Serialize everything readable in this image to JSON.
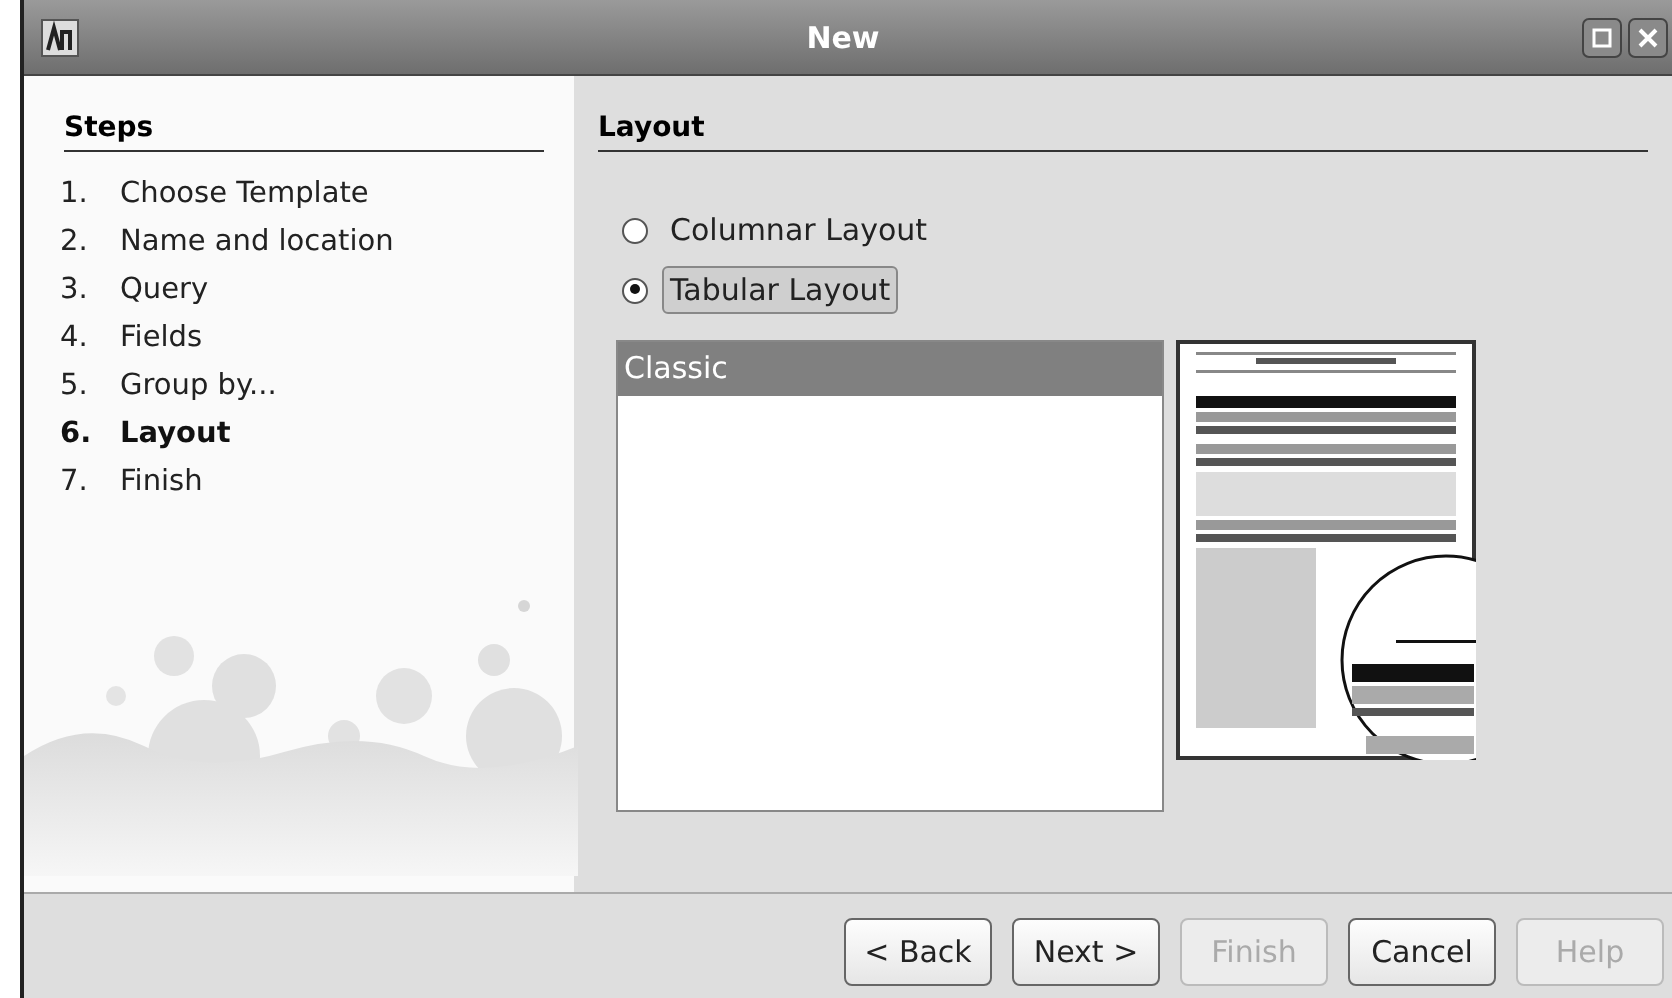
{
  "window": {
    "title": "New"
  },
  "steps": {
    "heading": "Steps",
    "items": [
      {
        "number": "1.",
        "label": "Choose Template",
        "selected": false
      },
      {
        "number": "2.",
        "label": "Name and location",
        "selected": false
      },
      {
        "number": "3.",
        "label": "Query",
        "selected": false
      },
      {
        "number": "4.",
        "label": "Fields",
        "selected": false
      },
      {
        "number": "5.",
        "label": "Group by...",
        "selected": false
      },
      {
        "number": "6.",
        "label": "Layout",
        "selected": true
      },
      {
        "number": "7.",
        "label": "Finish",
        "selected": false
      }
    ]
  },
  "page": {
    "heading": "Layout",
    "layout_options": [
      {
        "label": "Columnar Layout",
        "selected": false
      },
      {
        "label": "Tabular Layout",
        "selected": true
      }
    ],
    "templates": [
      {
        "label": "Classic",
        "selected": true
      }
    ]
  },
  "buttons": [
    {
      "label": "< Back",
      "disabled": false
    },
    {
      "label": "Next >",
      "disabled": false
    },
    {
      "label": "Finish",
      "disabled": true
    },
    {
      "label": "Cancel",
      "disabled": false
    },
    {
      "label": "Help",
      "disabled": true
    }
  ]
}
